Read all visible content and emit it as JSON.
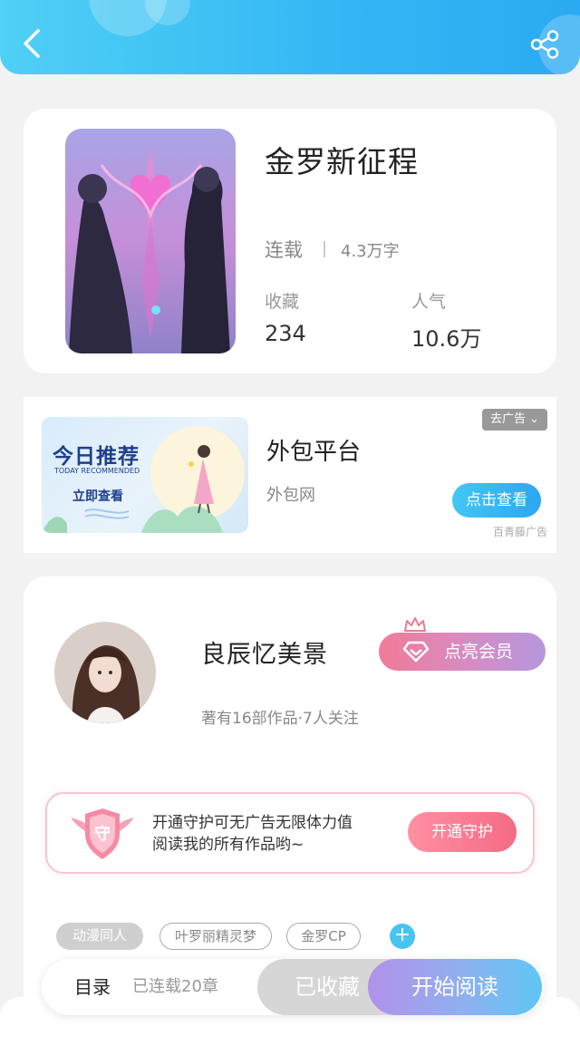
{
  "header": {
    "back_icon": "back-arrow-icon",
    "share_icon": "share-icon"
  },
  "book": {
    "title": "金罗新征程",
    "status": "连载",
    "word_count": "4.3万字",
    "favorites_label": "收藏",
    "favorites_value": "234",
    "popularity_label": "人气",
    "popularity_value": "10.6万"
  },
  "ad": {
    "banner_title": "今日推荐",
    "banner_subtitle": "TODAY RECOMMENDED",
    "banner_action": "立即查看",
    "title": "外包平台",
    "subtitle": "外包网",
    "close_label": "去广告",
    "button_label": "点击查看",
    "source": "百青藤广告"
  },
  "author": {
    "name": "良辰忆美景",
    "meta": "著有16部作品·7人关注",
    "vip_label": "点亮会员",
    "guard_badge_char": "守",
    "guard_line1": "开通守护可无广告无限体力值",
    "guard_line2": "阅读我的所有作品哟~",
    "guard_button": "开通守护"
  },
  "tags": [
    "动漫同人",
    "叶罗丽精灵梦",
    "金罗CP"
  ],
  "tag_add_label": "+",
  "bottom": {
    "toc_label": "目录",
    "chapters_label": "已连载20章",
    "collected_label": "已收藏",
    "read_label": "开始阅读"
  },
  "colors": {
    "header": "#34b6f4",
    "accent_blue": "#2ba7ef",
    "pink": "#f46b84",
    "purple": "#b291ea"
  }
}
